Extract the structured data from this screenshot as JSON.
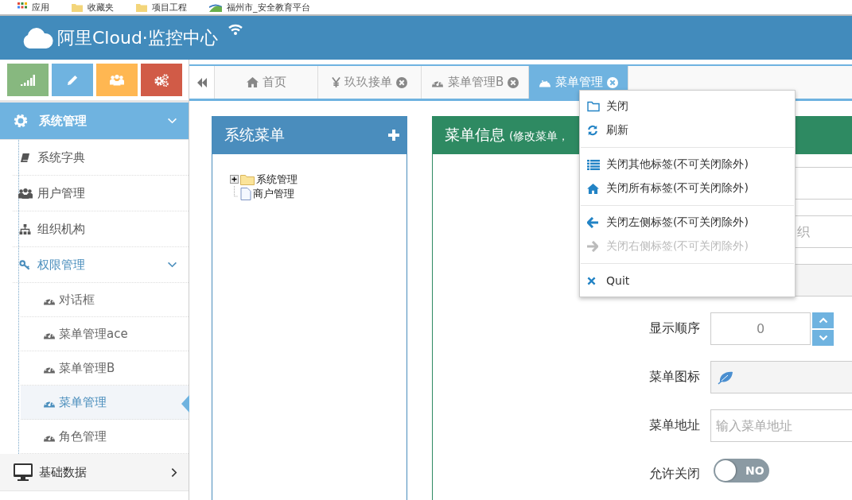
{
  "bookmarks": [
    {
      "kind": "apps",
      "label": "应用"
    },
    {
      "kind": "folder",
      "label": "收藏夹"
    },
    {
      "kind": "folder",
      "label": "项目工程"
    },
    {
      "kind": "site",
      "label": "福州市_安全教育平台"
    }
  ],
  "header": {
    "title": "阿里Cloud·监控中心"
  },
  "shortcuts": [
    {
      "kind": "signal",
      "color": "#87b87f"
    },
    {
      "kind": "pencil",
      "color": "#6fb3e0"
    },
    {
      "kind": "users",
      "color": "#ffb752"
    },
    {
      "kind": "cogs",
      "color": "#d15b47"
    }
  ],
  "sidebar": {
    "items": [
      {
        "label": "系统管理",
        "kind": "gear",
        "selected": true,
        "expanded": true,
        "children": [
          {
            "label": "系统字典",
            "kind": "book",
            "selected": false
          },
          {
            "label": "用户管理",
            "kind": "users",
            "selected": false
          },
          {
            "label": "组织机构",
            "kind": "sitemap",
            "selected": false
          },
          {
            "label": "权限管理",
            "kind": "key",
            "selected": false,
            "expanded": true,
            "children": [
              {
                "label": "对话框",
                "kind": "dashboard",
                "selected": false
              },
              {
                "label": "菜单管理ace",
                "kind": "dashboard",
                "selected": false
              },
              {
                "label": "菜单管理B",
                "kind": "dashboard",
                "selected": false
              },
              {
                "label": "菜单管理",
                "kind": "dashboard",
                "selected": true
              },
              {
                "label": "角色管理",
                "kind": "dashboard",
                "selected": false
              }
            ]
          }
        ]
      },
      {
        "label": "基础数据",
        "kind": "monitor",
        "selected": false,
        "expanded": false
      }
    ]
  },
  "tabs": [
    {
      "label": "首页",
      "kind": "home",
      "closable": false,
      "selected": false
    },
    {
      "label": "玖玖接单",
      "kind": "yen",
      "closable": true,
      "selected": false
    },
    {
      "label": "菜单管理B",
      "kind": "dashboard",
      "closable": true,
      "selected": false
    },
    {
      "label": "菜单管理",
      "kind": "dashboard",
      "closable": true,
      "selected": true
    }
  ],
  "tree_panel": {
    "title": "系统菜单",
    "nodes": [
      {
        "label": "系统管理",
        "kind": "folder",
        "expanded": false
      },
      {
        "label": "商户管理",
        "kind": "file"
      }
    ]
  },
  "info_panel": {
    "title": "菜单信息",
    "subtitle": "(修改菜单，",
    "fields": [
      {
        "kind": "text"
      },
      {
        "kind": "text",
        "placeholder": "织"
      },
      {
        "kind": "readonly"
      },
      {
        "kind": "spinner",
        "label": "显示顺序",
        "value": "0"
      },
      {
        "kind": "icon",
        "label": "菜单图标"
      },
      {
        "kind": "text",
        "label": "菜单地址",
        "placeholder": "输入菜单地址"
      },
      {
        "kind": "toggle",
        "label": "允许关闭",
        "on": false,
        "text": "NO"
      }
    ]
  },
  "context_menu": {
    "groups": [
      [
        {
          "kind": "folder",
          "label": "关闭",
          "disabled": false
        },
        {
          "kind": "refresh",
          "label": "刷新",
          "disabled": false
        }
      ],
      [
        {
          "kind": "list",
          "label": "关闭其他标签(不可关闭除外)",
          "disabled": false
        },
        {
          "kind": "home",
          "label": "关闭所有标签(不可关闭除外)",
          "disabled": false
        }
      ],
      [
        {
          "kind": "arrow-left",
          "label": "关闭左侧标签(不可关闭除外)",
          "disabled": false
        },
        {
          "kind": "arrow-right",
          "label": "关闭右侧标签(不可关闭除外)",
          "disabled": true
        }
      ],
      [
        {
          "kind": "times",
          "label": "Quit",
          "disabled": false
        }
      ]
    ]
  }
}
